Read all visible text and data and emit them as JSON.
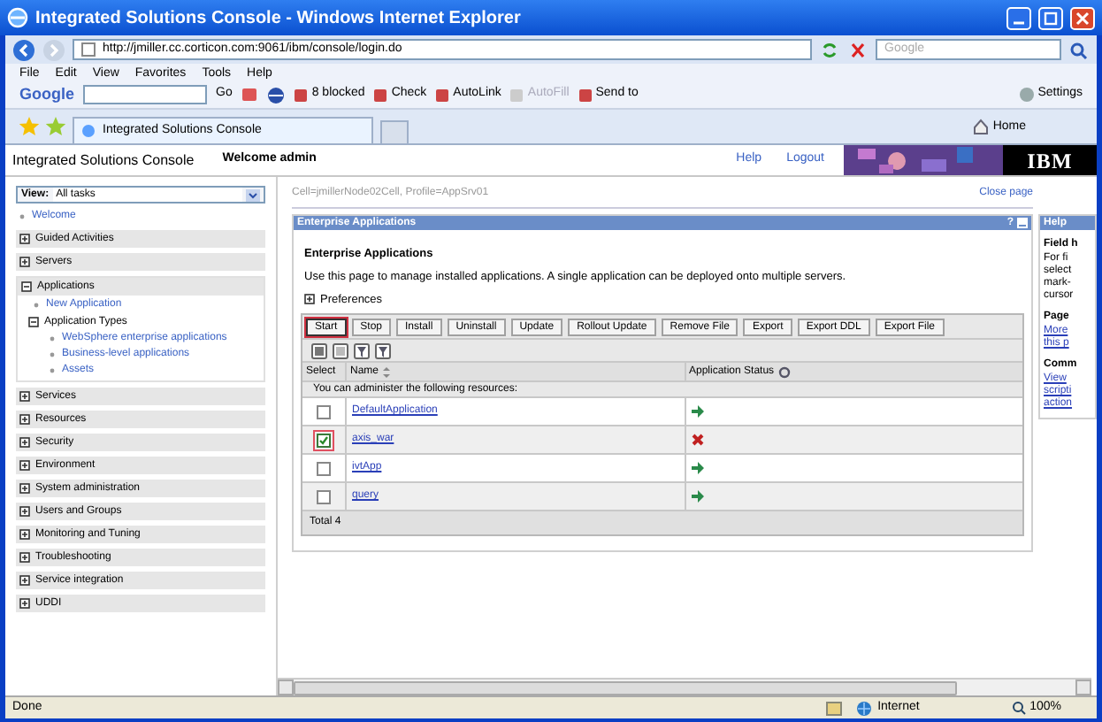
{
  "window": {
    "title": "Integrated Solutions Console - Windows Internet Explorer"
  },
  "address_bar": {
    "url": "http://jmiller.cc.corticon.com:9061/ibm/console/login.do",
    "search_placeholder": "Google"
  },
  "menu": [
    "File",
    "Edit",
    "View",
    "Favorites",
    "Tools",
    "Help"
  ],
  "google_toolbar": {
    "logo": "Google",
    "go": "Go",
    "items": [
      {
        "label": "8 blocked",
        "disabled": false
      },
      {
        "label": "Check",
        "disabled": false
      },
      {
        "label": "AutoLink",
        "disabled": false
      },
      {
        "label": "AutoFill",
        "disabled": true
      },
      {
        "label": "Send to",
        "disabled": false
      }
    ],
    "settings": "Settings"
  },
  "tabs": [
    {
      "label": "Integrated Solutions Console",
      "selected": true
    }
  ],
  "home": "Home",
  "console": {
    "title": "Integrated Solutions Console",
    "welcome": "Welcome admin",
    "links": [
      "Help",
      "Logout"
    ],
    "logo": "IBM"
  },
  "sidebar": {
    "view_label": "View:",
    "view_value": "All tasks",
    "items": [
      {
        "kind": "link",
        "label": "Welcome"
      },
      {
        "kind": "group",
        "label": "Guided Activities",
        "expanded": false
      },
      {
        "kind": "group",
        "label": "Servers",
        "expanded": false
      },
      {
        "kind": "group",
        "label": "Applications",
        "expanded": true,
        "children": [
          {
            "kind": "link",
            "label": "New Application"
          },
          {
            "kind": "group",
            "label": "Application Types",
            "expanded": true,
            "children": [
              {
                "kind": "link",
                "label": "WebSphere enterprise applications"
              },
              {
                "kind": "link",
                "label": "Business-level applications"
              },
              {
                "kind": "link",
                "label": "Assets"
              }
            ]
          }
        ]
      },
      {
        "kind": "group",
        "label": "Services",
        "expanded": false
      },
      {
        "kind": "group",
        "label": "Resources",
        "expanded": false
      },
      {
        "kind": "group",
        "label": "Security",
        "expanded": false
      },
      {
        "kind": "group",
        "label": "Environment",
        "expanded": false
      },
      {
        "kind": "group",
        "label": "System administration",
        "expanded": false
      },
      {
        "kind": "group",
        "label": "Users and Groups",
        "expanded": false
      },
      {
        "kind": "group",
        "label": "Monitoring and Tuning",
        "expanded": false
      },
      {
        "kind": "group",
        "label": "Troubleshooting",
        "expanded": false
      },
      {
        "kind": "group",
        "label": "Service integration",
        "expanded": false
      },
      {
        "kind": "group",
        "label": "UDDI",
        "expanded": false
      }
    ]
  },
  "breadcrumb": "Cell=jmillerNode02Cell, Profile=AppSrv01",
  "close_page": "Close page",
  "panel": {
    "title": "Enterprise Applications",
    "help": "?",
    "heading": "Enterprise Applications",
    "description": "Use this page to manage installed applications. A single application can be deployed onto multiple servers.",
    "preferences": "Preferences",
    "buttons": [
      {
        "label": "Start",
        "selected": true
      },
      {
        "label": "Stop",
        "selected": false
      },
      {
        "label": "Install",
        "selected": false
      },
      {
        "label": "Uninstall",
        "selected": false
      },
      {
        "label": "Update",
        "selected": false
      },
      {
        "label": "Rollout Update",
        "selected": false
      },
      {
        "label": "Remove File",
        "selected": false
      },
      {
        "label": "Export",
        "selected": false
      },
      {
        "label": "Export DDL",
        "selected": false
      },
      {
        "label": "Export File",
        "selected": false
      }
    ],
    "table": {
      "columns": [
        "Select",
        "Name",
        "Application Status"
      ],
      "info": "You can administer the following resources:",
      "rows": [
        {
          "name": "DefaultApplication",
          "checked": false,
          "running": true
        },
        {
          "name": "axis_war",
          "checked": true,
          "running": false
        },
        {
          "name": "ivtApp",
          "checked": false,
          "running": true
        },
        {
          "name": "query",
          "checked": false,
          "running": true
        }
      ],
      "total": "Total 4"
    }
  },
  "help_panel": {
    "title": "Help",
    "sections": [
      {
        "heading": "Field h",
        "body": [
          "For fi",
          "select",
          "mark-",
          "cursor"
        ],
        "kind": "text"
      },
      {
        "heading": "Page",
        "body": [
          "More",
          "this p"
        ],
        "kind": "link"
      },
      {
        "heading": "Comm",
        "body": [
          "View",
          "scripti",
          "action"
        ],
        "kind": "link"
      }
    ]
  },
  "status_bar": {
    "text": "Done",
    "zone": "Internet",
    "zoom": "100%"
  }
}
